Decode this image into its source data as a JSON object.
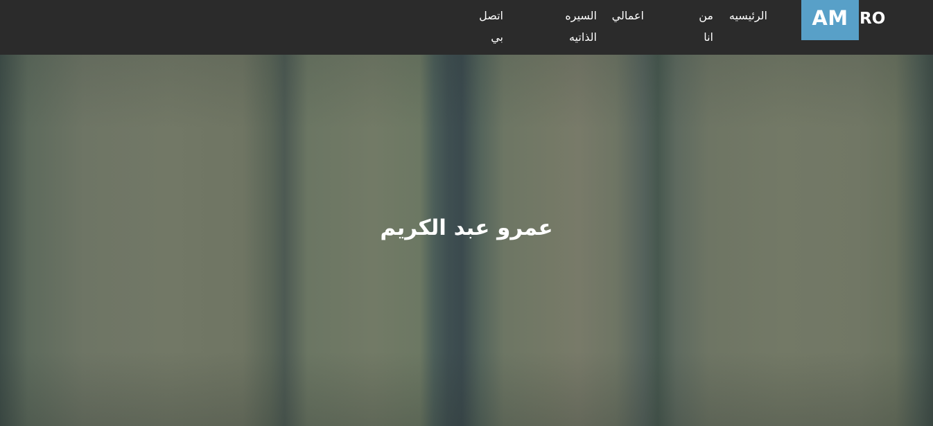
{
  "header": {
    "logo_highlight": "AM",
    "logo_rest": "RO",
    "nav": [
      {
        "id": "home",
        "line1": "الرئيسيه",
        "line2": ""
      },
      {
        "id": "about",
        "line1": "من",
        "line2": "انا"
      },
      {
        "id": "works",
        "line1": "اعمالي",
        "line2": ""
      },
      {
        "id": "cv",
        "line1": "السيره",
        "line2": "الذاتيه"
      },
      {
        "id": "contact",
        "line1": "اتصل",
        "line2": "بي"
      }
    ]
  },
  "hero": {
    "title": "عمرو عبد الكريم"
  },
  "colors": {
    "navbar_bg": "#2b2b2b",
    "logo_accent": "#58a0c8",
    "text": "#ffffff"
  }
}
